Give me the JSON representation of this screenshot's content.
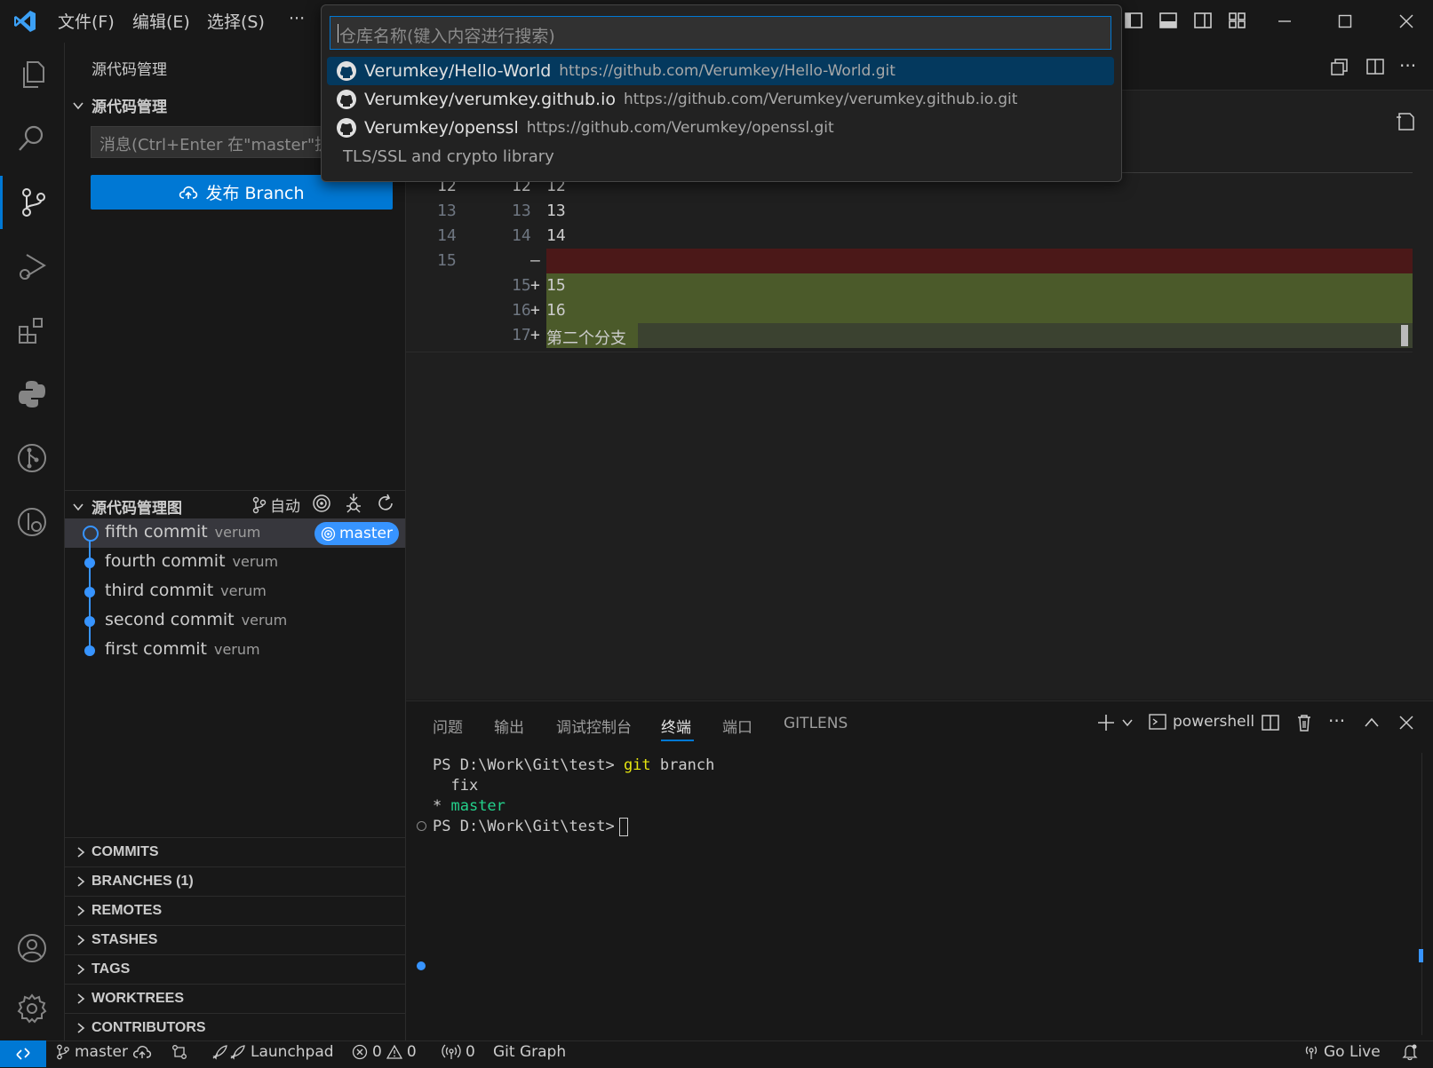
{
  "titlebar": {
    "menus": [
      "文件(F)",
      "编辑(E)",
      "选择(S)",
      "···"
    ]
  },
  "quickpick": {
    "placeholder": "仓库名称(键入内容进行搜索)",
    "items": [
      {
        "label": "Verumkey/Hello-World",
        "desc": "https://github.com/Verumkey/Hello-World.git"
      },
      {
        "label": "Verumkey/verumkey.github.io",
        "desc": "https://github.com/Verumkey/verumkey.github.io.git"
      },
      {
        "label": "Verumkey/openssl",
        "desc": "https://github.com/Verumkey/openssl.git"
      }
    ],
    "detail": "TLS/SSL and crypto library"
  },
  "sidebar": {
    "title": "源代码管理",
    "section_title": "源代码管理",
    "message_placeholder": "消息(Ctrl+Enter 在\"master\"提交)",
    "publish_label": "发布 Branch",
    "graph_title": "源代码管理图",
    "auto_label": "自动",
    "commits": [
      {
        "msg": "fifth commit",
        "author": "verum",
        "branch": "master"
      },
      {
        "msg": "fourth commit",
        "author": "verum"
      },
      {
        "msg": "third commit",
        "author": "verum"
      },
      {
        "msg": "second commit",
        "author": "verum"
      },
      {
        "msg": "first commit",
        "author": "verum"
      }
    ],
    "gitlens_sections": [
      "COMMITS",
      "BRANCHES (1)",
      "REMOTES",
      "STASHES",
      "TAGS",
      "WORKTREES",
      "CONTRIBUTORS"
    ]
  },
  "diff": {
    "rows": [
      {
        "left": "12",
        "right": "12",
        "sign": "",
        "text": "12",
        "type": "ctx"
      },
      {
        "left": "13",
        "right": "13",
        "sign": "",
        "text": "13",
        "type": "ctx"
      },
      {
        "left": "14",
        "right": "14",
        "sign": "",
        "text": "14",
        "type": "ctx"
      },
      {
        "left": "15",
        "right": "",
        "sign": "—",
        "text": "",
        "type": "del"
      },
      {
        "left": "",
        "right": "15",
        "sign": "+",
        "text": "15",
        "type": "add"
      },
      {
        "left": "",
        "right": "16",
        "sign": "+",
        "text": "16",
        "type": "add"
      },
      {
        "left": "",
        "right": "17",
        "sign": "+",
        "text": "第二个分支",
        "type": "add2"
      }
    ]
  },
  "panel": {
    "tabs": [
      "问题",
      "输出",
      "调试控制台",
      "终端",
      "端口",
      "GITLENS"
    ],
    "active_tab": "终端",
    "shell": "powershell",
    "terminal_lines": [
      {
        "prompt": "PS D:\\Work\\Git\\test> ",
        "cmd": "git",
        "args": " branch"
      },
      {
        "text": "  fix"
      },
      {
        "star": "* ",
        "branch": "master"
      },
      {
        "prompt": "PS D:\\Work\\Git\\test> "
      }
    ]
  },
  "statusbar": {
    "branch": "master",
    "launchpad": "Launchpad",
    "errors": "0",
    "warnings": "0",
    "ports": "0",
    "git_graph": "Git Graph",
    "go_live": "Go Live"
  },
  "colors": {
    "accent": "#0078d4",
    "button": "#0078d4",
    "diff_del": "#4b1818",
    "diff_add": "#4b5a2a",
    "diff_add2": "#3b4230",
    "commit_dot": "#3794ff"
  }
}
